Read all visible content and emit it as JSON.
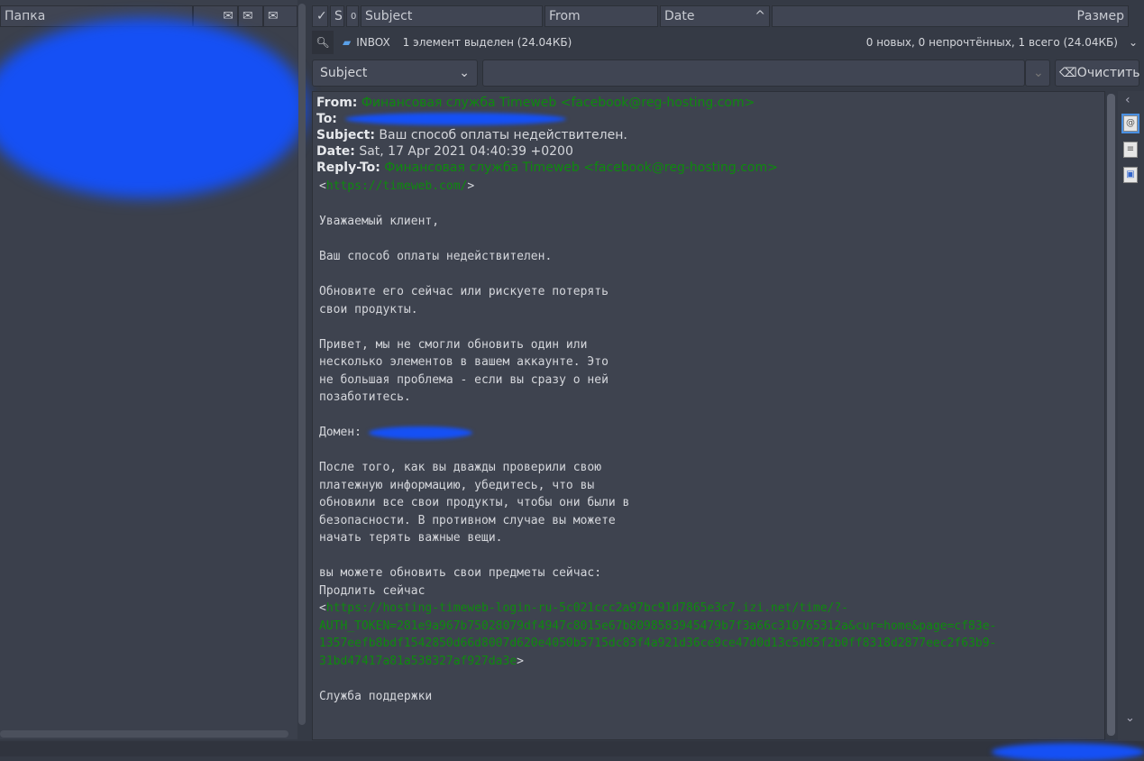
{
  "folder_panel": {
    "header": "Папка"
  },
  "columns": {
    "check": "✓",
    "status": "S",
    "attach": "0",
    "subject": "Subject",
    "from": "From",
    "date": "Date",
    "size": "Размер"
  },
  "status": {
    "folder": "INBOX",
    "selected": "1 элемент выделен (24.04КБ)",
    "summary": "0 новых, 0 непрочтённых, 1 всего (24.04КБ)"
  },
  "search": {
    "field": "Subject",
    "value": "",
    "clear_label": "Очистить"
  },
  "message": {
    "from_label": "From:",
    "from": "Финансовая служба Timeweb  <facebook@reg-hosting.com>",
    "to_label": "To:",
    "subject_label": "Subject:",
    "subject": "Ваш способ оплаты недействителен.",
    "date_label": "Date:",
    "date": "Sat, 17 Apr 2021 04:40:39 +0200",
    "replyto_label": "Reply-To:",
    "replyto": "Финансовая служба Timeweb <facebook@reg-hosting.com>",
    "link1": "https://timeweb.com/",
    "p1": "Уважаемый клиент,",
    "p2": "Ваш способ оплаты недействителен.",
    "p3": "Обновите его сейчас или рискуете потерять\nсвои продукты.",
    "p4": "Привет, мы не смогли обновить один или\nнесколько элементов в вашем аккаунте. Это\nне большая проблема - если вы сразу о ней\nпозаботитесь.",
    "domain_label": "Домен: ",
    "p5": "После того, как вы дважды проверили свою\nплатежную информацию, убедитесь, что вы\nобновили все свои продукты, чтобы они были в\nбезопасности. В противном случае вы можете\nначать терять важные вещи.",
    "p6": "вы можете обновить свои предметы сейчас:\nПродлить сейчас",
    "link2": "https://hosting-timeweb-login-ru-5c021ccc2a97bc91d7865e3c7.izi.net/time/?-\nAUTH_TOKEN=281e9a967b75028079df4947c8015e67b8098583945479b7f3a66c310765312a&cur=home&page=cf83e-\n1357eefb8bdf1542850d66d8007d620e4050b5715dc83f4a921d36ce9ce47d0d13c5d85f2b0ff8318d2877eec2f63b9-\n31bd47417a81a538327af927da3e",
    "sign": "Служба поддержки"
  },
  "colors": {
    "link": "#0e8a0e",
    "redaction": "#1550f5"
  }
}
